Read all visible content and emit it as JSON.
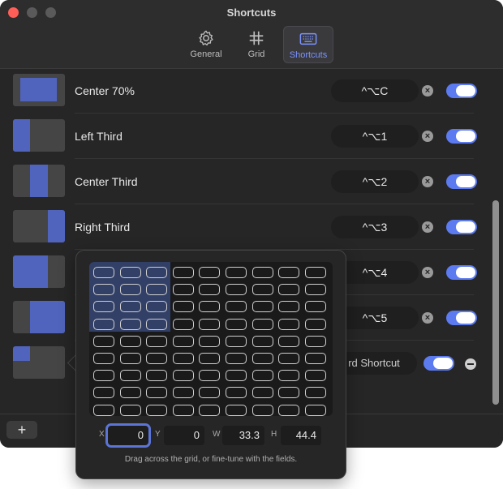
{
  "window": {
    "title": "Shortcuts"
  },
  "tabs": [
    {
      "label": "General",
      "icon": "gear-icon"
    },
    {
      "label": "Grid",
      "icon": "grid-icon"
    },
    {
      "label": "Shortcuts",
      "icon": "keyboard-icon",
      "selected": true
    }
  ],
  "rows": [
    {
      "label": "Center 70%",
      "shortcut": "^⌥C",
      "enabled": true
    },
    {
      "label": "Left Third",
      "shortcut": "^⌥1",
      "enabled": true
    },
    {
      "label": "Center Third",
      "shortcut": "^⌥2",
      "enabled": true
    },
    {
      "label": "Right Third",
      "shortcut": "^⌥3",
      "enabled": true
    },
    {
      "label": "",
      "shortcut": "^⌥4",
      "enabled": true
    },
    {
      "label": "",
      "shortcut": "^⌥5",
      "enabled": true
    },
    {
      "label": "",
      "shortcut_button": "rd Shortcut",
      "enabled": true
    }
  ],
  "popover": {
    "grid": {
      "columns": 9,
      "rows": 9,
      "selected_cols": 3,
      "selected_rows": 4
    },
    "fields": {
      "x_label": "X",
      "x": "0",
      "y_label": "Y",
      "y": "0",
      "w_label": "W",
      "w": "33.3",
      "h_label": "H",
      "h": "44.4"
    },
    "hint": "Drag across the grid, or fine-tune with the fields."
  },
  "bottom": {
    "add_label": "+"
  },
  "colors": {
    "accent": "#5c7bf0",
    "thumb_fill": "#5164bd"
  }
}
